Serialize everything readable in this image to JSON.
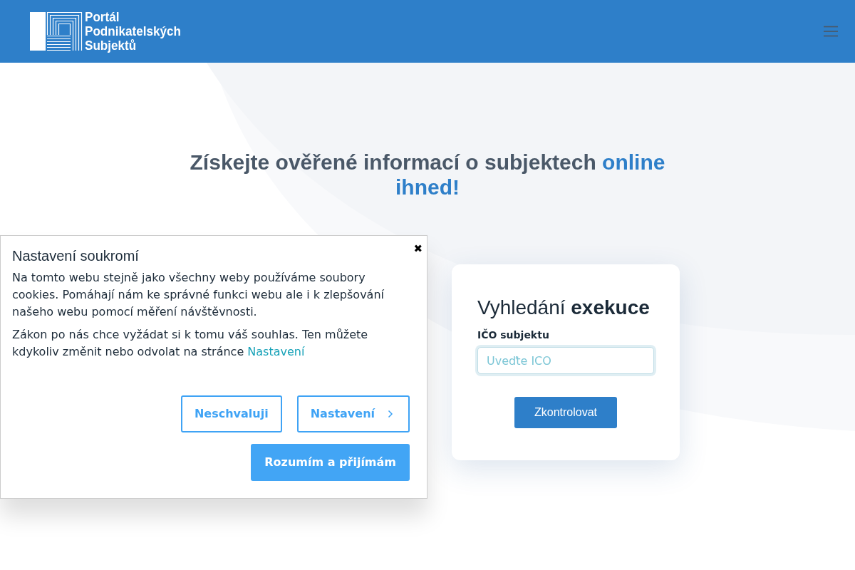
{
  "header": {
    "logo_lines": [
      "Portál",
      "Podnikatelských",
      "Subjektů"
    ]
  },
  "hero": {
    "heading": "Získejte ověřené informací o subjektech",
    "heading_highlight": "online ihned!"
  },
  "cookie_dialog": {
    "title": "Nastavení soukromí",
    "close": "✖",
    "paragraphs": [
      {
        "text": "Na tomto webu stejně jako všechny weby používáme soubory cookies. Pomáhají nám ke správné funkci webu ale i k zlepšování našeho webu pomocí měření návštěvnosti."
      },
      {
        "text": "Zákon po nás chce vyžádat si k tomu váš souhlas. Ten můžete kdykoliv změnit nebo odvolat na stránce",
        "link": "Nastavení"
      }
    ],
    "buttons": [
      {
        "label": "Neschvaluji",
        "kind": "outline"
      },
      {
        "label": "Nastavení",
        "kind": "outline-next"
      },
      {
        "label": "Rozumím a přijímám",
        "kind": "solid"
      }
    ]
  },
  "search_card": {
    "title": "Vyhledání **exekuce**",
    "field_label": "IČO subjektu",
    "input": {
      "placeholder": "Uveďte ICO",
      "focused": true
    },
    "button": "Zkontrolovat"
  }
}
